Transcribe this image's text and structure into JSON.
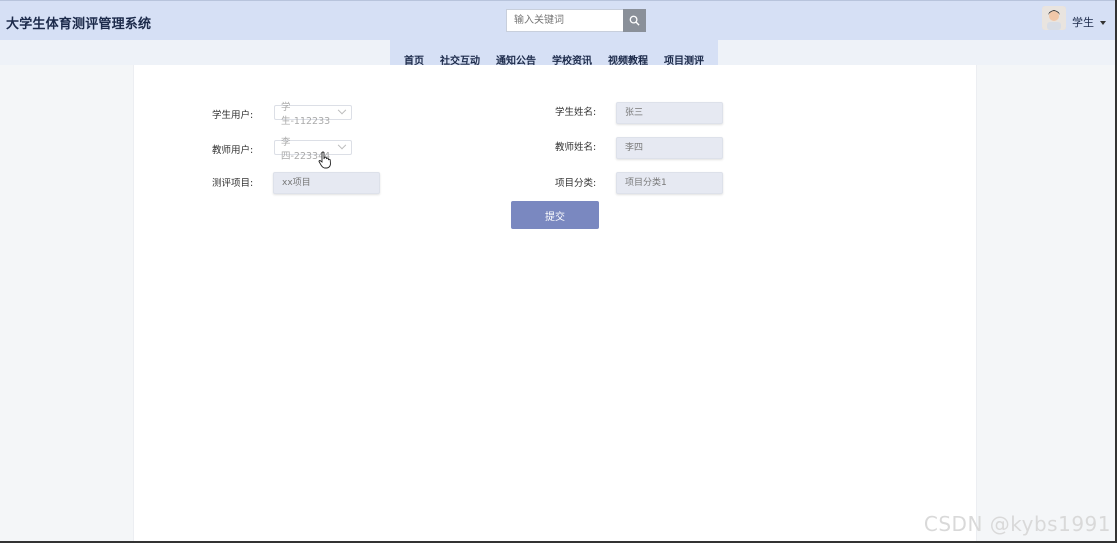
{
  "header": {
    "app_title": "大学生体育测评管理系统",
    "search_placeholder": "输入关键词",
    "user_label": "学生"
  },
  "nav": {
    "items": [
      "首页",
      "社交互动",
      "通知公告",
      "学校资讯",
      "视频教程",
      "项目测评"
    ]
  },
  "form": {
    "student_user_label": "学生用户:",
    "student_user_value": "学生-112233",
    "student_name_label": "学生姓名:",
    "student_name_value": "张三",
    "teacher_user_label": "教师用户:",
    "teacher_user_value": "李四-223344",
    "teacher_name_label": "教师姓名:",
    "teacher_name_value": "李四",
    "project_label": "测评项目:",
    "project_value": "xx项目",
    "category_label": "项目分类:",
    "category_value": "项目分类1",
    "submit_label": "提交"
  },
  "watermark": "CSDN @kybs1991",
  "colors": {
    "header_bg": "#d6e0f5",
    "button_bg": "#7a88c0",
    "field_bg": "#e6e9f2"
  }
}
